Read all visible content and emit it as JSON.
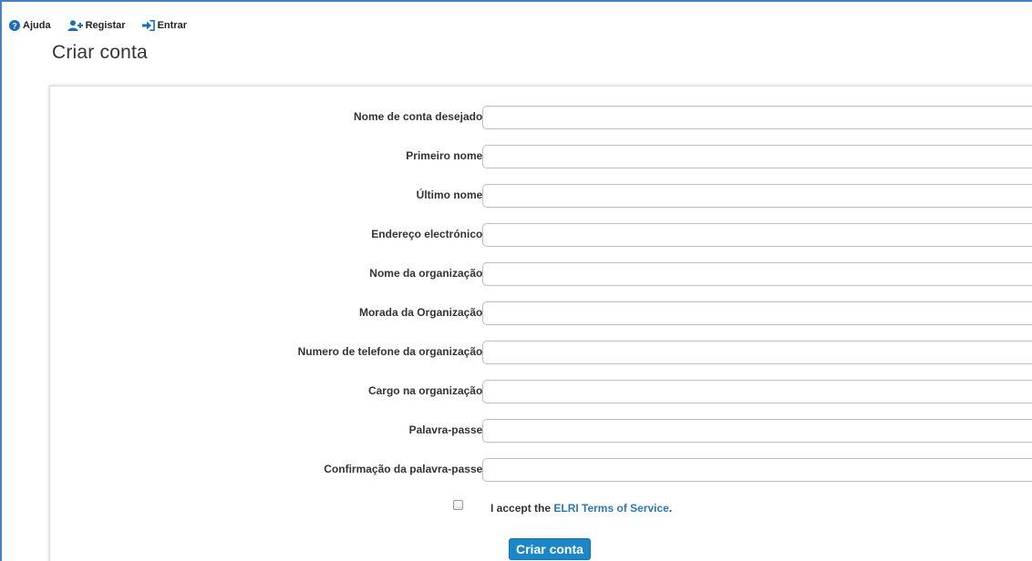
{
  "nav": {
    "items": [
      {
        "label": "Ajuda",
        "icon": "help-circle-icon"
      },
      {
        "label": "Registar",
        "icon": "add-user-icon"
      },
      {
        "label": "Entrar",
        "icon": "sign-in-icon"
      }
    ]
  },
  "page": {
    "title": "Criar conta"
  },
  "form": {
    "required_marker": "*",
    "fields": [
      {
        "label": "Nome de conta desejado",
        "value": ""
      },
      {
        "label": "Primeiro nome",
        "value": ""
      },
      {
        "label": "Último nome",
        "value": ""
      },
      {
        "label": "Endereço electrónico",
        "value": ""
      },
      {
        "label": "Nome da organização",
        "value": ""
      },
      {
        "label": "Morada da Organização",
        "value": ""
      },
      {
        "label": "Numero de telefone da organização",
        "value": ""
      },
      {
        "label": "Cargo na organização",
        "value": ""
      },
      {
        "label": "Palavra-passe",
        "value": ""
      },
      {
        "label": "Confirmação da palavra-passe",
        "value": ""
      }
    ],
    "tos": {
      "prefix": "I accept the ",
      "link_text": "ELRI Terms of Service",
      "suffix": ".",
      "checked": false
    },
    "submit_label": "Criar conta"
  },
  "colors": {
    "accent": "#1b87c9",
    "link": "#2a7ab6",
    "required": "#d9302b",
    "frame": "#4a7fc0"
  }
}
